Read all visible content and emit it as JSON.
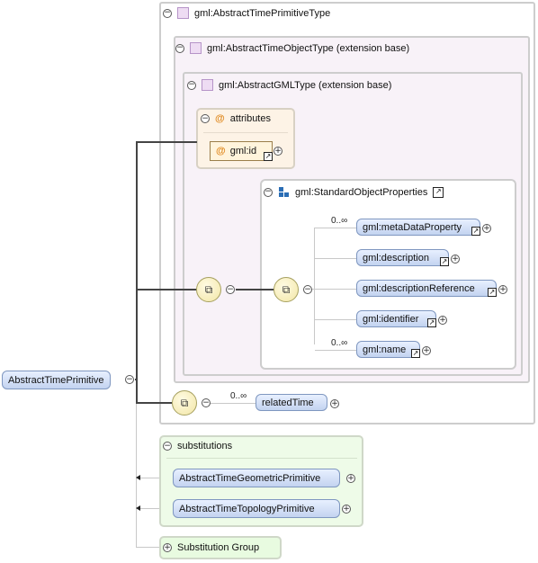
{
  "root": {
    "label": "AbstractTimePrimitive"
  },
  "complex_type": {
    "label": "gml:AbstractTimePrimitiveType"
  },
  "time_object_type": {
    "label": "gml:AbstractTimeObjectType (extension base)"
  },
  "gml_type": {
    "label": "gml:AbstractGMLType (extension base)"
  },
  "attributes": {
    "label": "attributes",
    "icon": "@",
    "items": [
      {
        "label": "gml:id"
      }
    ]
  },
  "group": {
    "label": "gml:StandardObjectProperties"
  },
  "elements": [
    {
      "label": "gml:metaDataProperty",
      "cardinality": "0..∞"
    },
    {
      "label": "gml:description",
      "cardinality": ""
    },
    {
      "label": "gml:descriptionReference",
      "cardinality": ""
    },
    {
      "label": "gml:identifier",
      "cardinality": ""
    },
    {
      "label": "gml:name",
      "cardinality": "0..∞"
    }
  ],
  "related": {
    "label": "relatedTime",
    "cardinality": "0..∞"
  },
  "substitutions": {
    "label": "substitutions",
    "items": [
      {
        "label": "AbstractTimeGeometricPrimitive"
      },
      {
        "label": "AbstractTimeTopologyPrimitive"
      }
    ]
  },
  "substitution_group": {
    "label": "Substitution Group"
  },
  "colors": {
    "frame": "#cdcdcd",
    "type_bg": "#f8f2f8",
    "attributes_bg": "#fdf3e6",
    "substitutions_bg": "#eefbe8",
    "element_fill": "#c3d3f0"
  }
}
